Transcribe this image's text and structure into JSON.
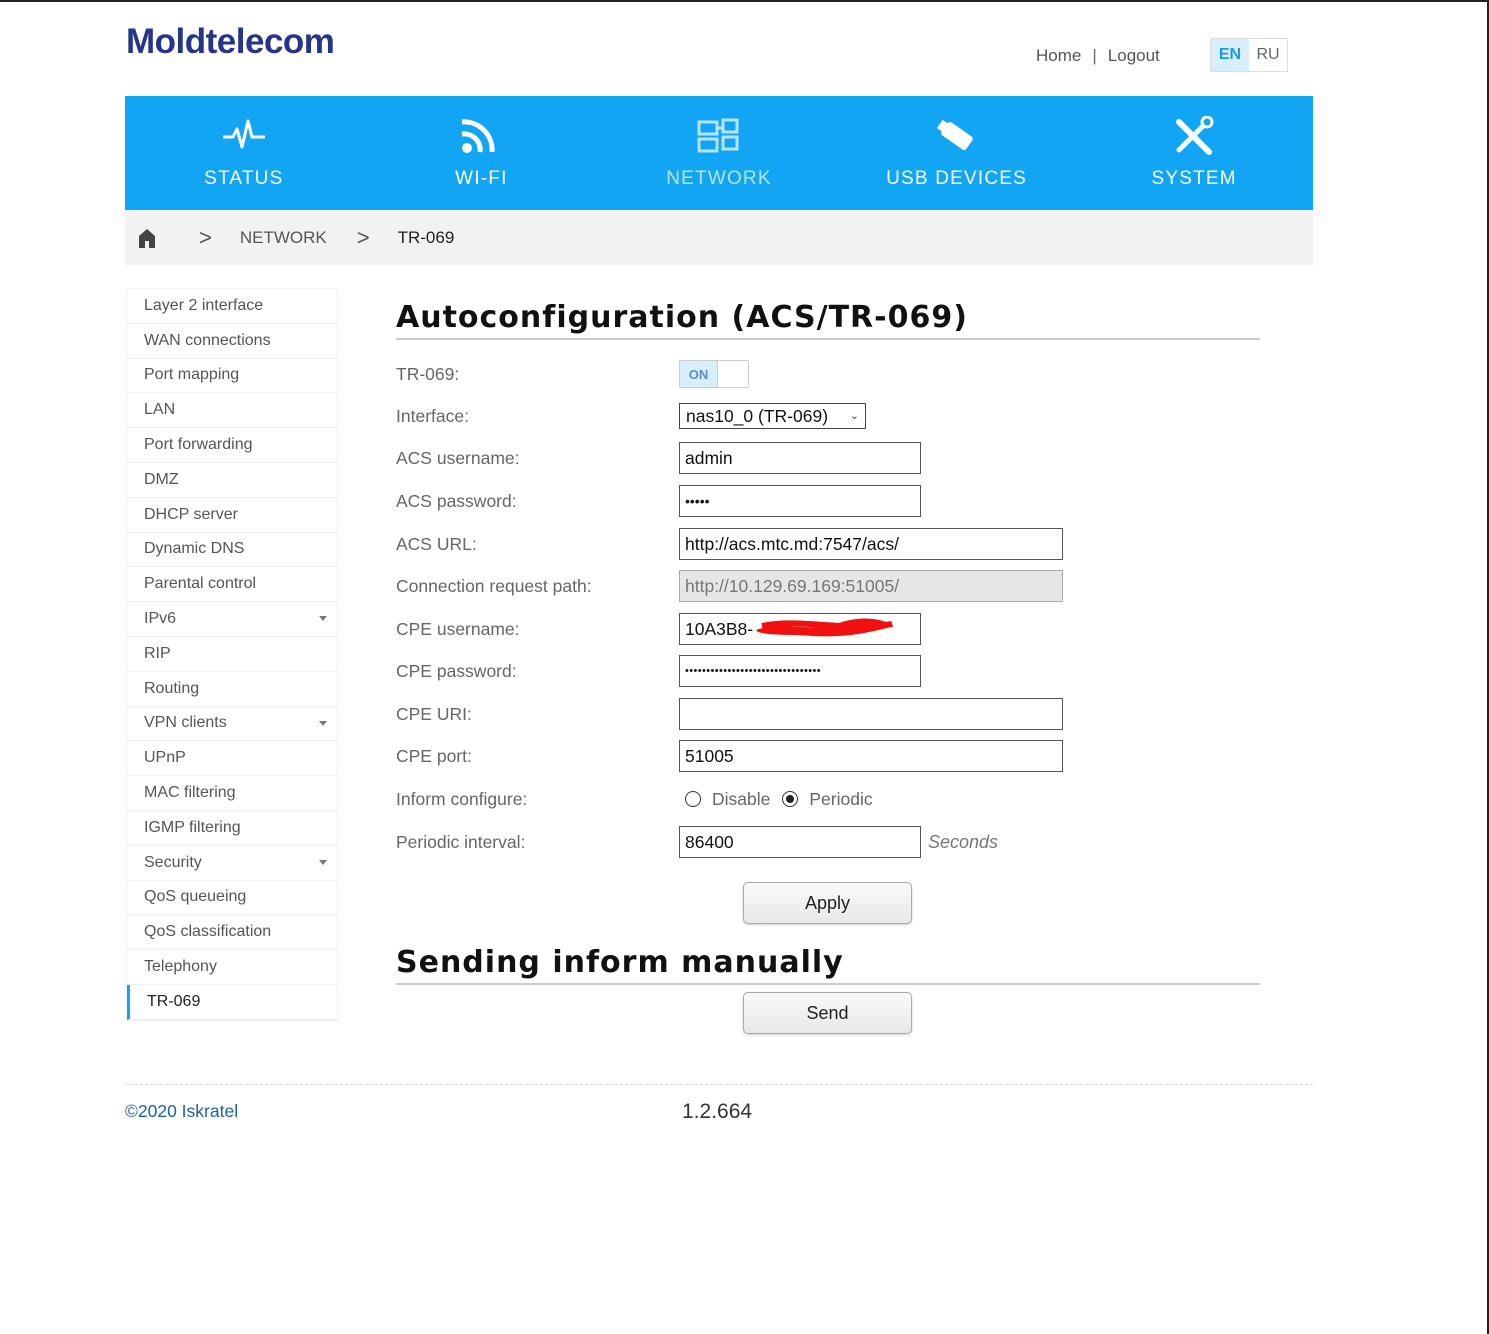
{
  "brand": {
    "logo": "Moldtelecom"
  },
  "toplinks": {
    "home": "Home",
    "separator": "|",
    "logout": "Logout"
  },
  "lang": {
    "en": "EN",
    "ru": "RU"
  },
  "nav": {
    "items": [
      {
        "label": "STATUS",
        "icon": "pulse-icon"
      },
      {
        "label": "WI-FI",
        "icon": "wifi-icon"
      },
      {
        "label": "NETWORK",
        "icon": "network-icon"
      },
      {
        "label": "USB DEVICES",
        "icon": "usb-icon"
      },
      {
        "label": "SYSTEM",
        "icon": "tools-icon"
      }
    ]
  },
  "breadcrumb": {
    "level1": "NETWORK",
    "level2": "TR-069"
  },
  "sidebar": {
    "items": [
      {
        "label": "Layer 2 interface"
      },
      {
        "label": "WAN connections"
      },
      {
        "label": "Port mapping"
      },
      {
        "label": "LAN"
      },
      {
        "label": "Port forwarding"
      },
      {
        "label": "DMZ"
      },
      {
        "label": "DHCP server"
      },
      {
        "label": "Dynamic DNS"
      },
      {
        "label": "Parental control"
      },
      {
        "label": "IPv6"
      },
      {
        "label": "RIP"
      },
      {
        "label": "Routing"
      },
      {
        "label": "VPN clients"
      },
      {
        "label": "UPnP"
      },
      {
        "label": "MAC filtering"
      },
      {
        "label": "IGMP filtering"
      },
      {
        "label": "Security"
      },
      {
        "label": "QoS queueing"
      },
      {
        "label": "QoS classification"
      },
      {
        "label": "Telephony"
      },
      {
        "label": "TR-069"
      }
    ]
  },
  "form": {
    "title": "Autoconfiguration (ACS/TR-069)",
    "tr069": {
      "label": "TR-069:",
      "state": "ON"
    },
    "interface": {
      "label": "Interface:",
      "value": "nas10_0 (TR-069)"
    },
    "acs_username": {
      "label": "ACS username:",
      "value": "admin"
    },
    "acs_password": {
      "label": "ACS password:",
      "value": "•••••"
    },
    "acs_url": {
      "label": "ACS URL:",
      "value": "http://acs.mtc.md:7547/acs/"
    },
    "conn_req_path": {
      "label": "Connection request path:",
      "value": "http://10.129.69.169:51005/"
    },
    "cpe_username": {
      "label": "CPE username:",
      "value": "10A3B8-"
    },
    "cpe_password": {
      "label": "CPE password:",
      "value": "••••••••••••••••••••••••••••••••"
    },
    "cpe_uri": {
      "label": "CPE URI:",
      "value": ""
    },
    "cpe_port": {
      "label": "CPE port:",
      "value": "51005"
    },
    "inform": {
      "label": "Inform configure:",
      "opt1": "Disable",
      "opt2": "Periodic",
      "selected": "Periodic"
    },
    "periodic": {
      "label": "Periodic interval:",
      "value": "86400",
      "unit": "Seconds"
    },
    "apply": "Apply"
  },
  "manual": {
    "title": "Sending inform manually",
    "send": "Send"
  },
  "footer": {
    "copyright": "©2020 Iskratel",
    "version": "1.2.664"
  },
  "colors": {
    "accent": "#12a5f4",
    "brand": "#25358a"
  }
}
